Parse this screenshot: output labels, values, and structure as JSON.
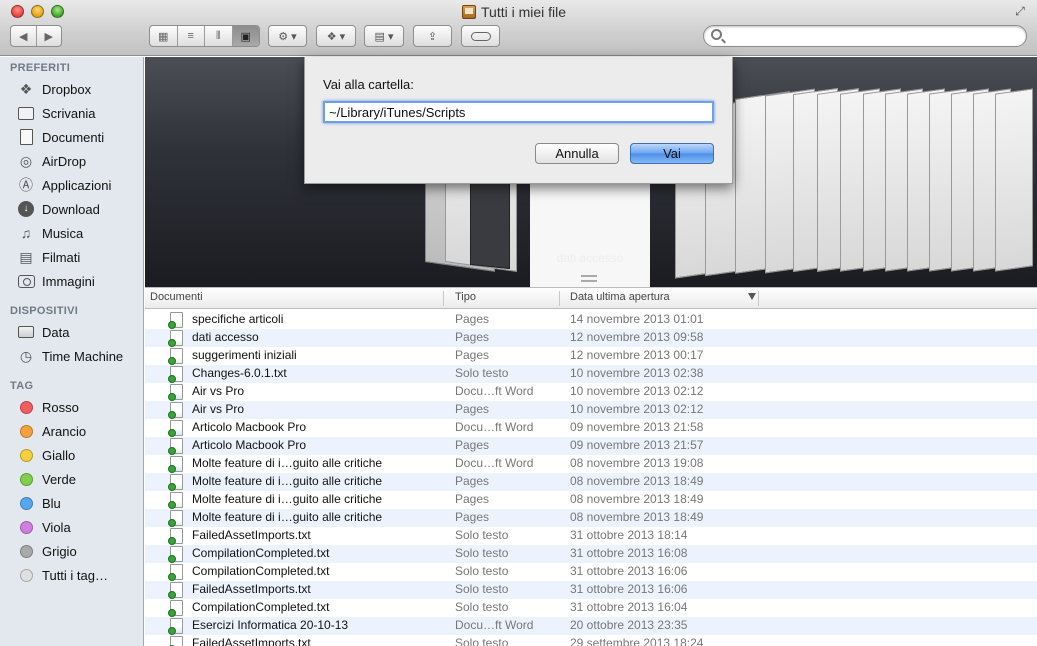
{
  "window": {
    "title": "Tutti i miei file"
  },
  "toolbar": {
    "back_icon": "chevron-left",
    "forward_icon": "chevron-right",
    "view_icons": [
      "grid",
      "list",
      "columns",
      "coverflow"
    ],
    "active_view": "coverflow",
    "search_placeholder": ""
  },
  "sidebar": {
    "favorites_header": "PREFERITI",
    "favorites": [
      {
        "label": "Dropbox",
        "icon": "dropbox-icon"
      },
      {
        "label": "Scrivania",
        "icon": "desktop-icon"
      },
      {
        "label": "Documenti",
        "icon": "documents-icon"
      },
      {
        "label": "AirDrop",
        "icon": "airdrop-icon"
      },
      {
        "label": "Applicazioni",
        "icon": "applications-icon"
      },
      {
        "label": "Download",
        "icon": "download-icon"
      },
      {
        "label": "Musica",
        "icon": "music-icon"
      },
      {
        "label": "Filmati",
        "icon": "movies-icon"
      },
      {
        "label": "Immagini",
        "icon": "camera-icon"
      }
    ],
    "devices_header": "DISPOSITIVI",
    "devices": [
      {
        "label": "Data",
        "icon": "disk-icon"
      },
      {
        "label": "Time Machine",
        "icon": "time-machine-icon"
      }
    ],
    "tags_header": "TAG",
    "tags": [
      {
        "label": "Rosso",
        "color": "#f25d5d"
      },
      {
        "label": "Arancio",
        "color": "#f6a13c"
      },
      {
        "label": "Giallo",
        "color": "#f4d03b"
      },
      {
        "label": "Verde",
        "color": "#7fcf4a"
      },
      {
        "label": "Blu",
        "color": "#56a8ee"
      },
      {
        "label": "Viola",
        "color": "#d27de0"
      },
      {
        "label": "Grigio",
        "color": "#a9a9a9"
      },
      {
        "label": "Tutti i tag…",
        "color": "#e0e0e0"
      }
    ]
  },
  "coverflow": {
    "caption": "dati accesso"
  },
  "dialog": {
    "label": "Vai alla cartella:",
    "path_value": "~/Library/iTunes/Scripts",
    "cancel_label": "Annulla",
    "go_label": "Vai"
  },
  "list": {
    "columns": [
      "Documenti",
      "Tipo",
      "Data ultima apertura"
    ],
    "rows": [
      {
        "name": "specifiche articoli",
        "type": "Pages",
        "date": "14 novembre 2013 01:01",
        "kind": "pages"
      },
      {
        "name": "dati accesso",
        "type": "Pages",
        "date": "12 novembre 2013 09:58",
        "kind": "pages"
      },
      {
        "name": "suggerimenti iniziali",
        "type": "Pages",
        "date": "12 novembre 2013 00:17",
        "kind": "pages"
      },
      {
        "name": "Changes-6.0.1.txt",
        "type": "Solo testo",
        "date": "10 novembre 2013 02:38",
        "kind": "text"
      },
      {
        "name": "Air vs Pro",
        "type": "Docu…ft Word",
        "date": "10 novembre 2013 02:12",
        "kind": "word"
      },
      {
        "name": "Air vs Pro",
        "type": "Pages",
        "date": "10 novembre 2013 02:12",
        "kind": "pages"
      },
      {
        "name": "Articolo Macbook Pro",
        "type": "Docu…ft Word",
        "date": "09 novembre 2013 21:58",
        "kind": "word"
      },
      {
        "name": "Articolo Macbook Pro",
        "type": "Pages",
        "date": "09 novembre 2013 21:57",
        "kind": "pages"
      },
      {
        "name": "Molte feature di i…guito alle critiche",
        "type": "Docu…ft Word",
        "date": "08 novembre 2013 19:08",
        "kind": "word"
      },
      {
        "name": "Molte feature di i…guito alle critiche",
        "type": "Pages",
        "date": "08 novembre 2013 18:49",
        "kind": "pages"
      },
      {
        "name": "Molte feature di i…guito alle critiche",
        "type": "Pages",
        "date": "08 novembre 2013 18:49",
        "kind": "pages"
      },
      {
        "name": "Molte feature di i…guito alle critiche",
        "type": "Pages",
        "date": "08 novembre 2013 18:49",
        "kind": "pages"
      },
      {
        "name": "FailedAssetImports.txt",
        "type": "Solo testo",
        "date": "31 ottobre 2013 18:14",
        "kind": "text"
      },
      {
        "name": "CompilationCompleted.txt",
        "type": "Solo testo",
        "date": "31 ottobre 2013 16:08",
        "kind": "text"
      },
      {
        "name": "CompilationCompleted.txt",
        "type": "Solo testo",
        "date": "31 ottobre 2013 16:06",
        "kind": "text"
      },
      {
        "name": "FailedAssetImports.txt",
        "type": "Solo testo",
        "date": "31 ottobre 2013 16:06",
        "kind": "text"
      },
      {
        "name": "CompilationCompleted.txt",
        "type": "Solo testo",
        "date": "31 ottobre 2013 16:04",
        "kind": "text"
      },
      {
        "name": "Esercizi Informatica 20-10-13",
        "type": "Docu…ft Word",
        "date": "20 ottobre 2013 23:35",
        "kind": "word"
      },
      {
        "name": "FailedAssetImports.txt",
        "type": "Solo testo",
        "date": "29 settembre 2013 18:24",
        "kind": "text"
      }
    ]
  }
}
